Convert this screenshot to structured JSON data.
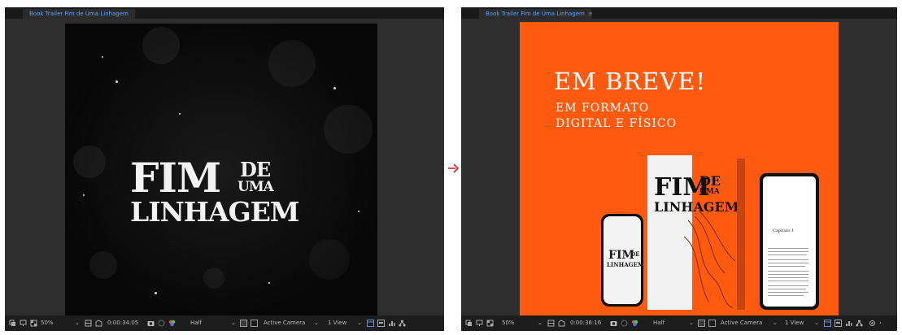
{
  "left_panel": {
    "tab_label": "Book Trailer Fim de Uma Linhagem",
    "logo": {
      "line1_main": "FIM",
      "line1_de": "DE",
      "line1_uma": "UMA",
      "line2": "LINHAGEM"
    },
    "toolbar": {
      "zoom": "50%",
      "timecode": "0:00:34:05",
      "resolution": "Half",
      "camera": "Active Camera",
      "views": "1 View"
    }
  },
  "right_panel": {
    "tab_label": "Book Trailer Fim de Uma Linhagem",
    "tab_menu_glyph": "≡",
    "headline": "EM BREVE!",
    "subline1": "EM FORMATO",
    "subline2": "DIGITAL E FÍSICO",
    "book_logo": {
      "main": "FIM",
      "de": "DE",
      "uma": "UMA",
      "line2": "LINHAGEM"
    },
    "tablet_chapter": "Capítulo 1",
    "toolbar": {
      "zoom": "50%",
      "timecode": "0:00:36:16",
      "resolution": "Half",
      "camera": "Active Camera",
      "views": "1 View"
    }
  },
  "colors": {
    "accent": "#5aa3ff",
    "orange_bg": "#ff5a10",
    "arrow": "#e02020"
  },
  "icons": [
    "toggle-mask-icon",
    "region-of-interest-icon",
    "transparency-grid-icon",
    "snapshot-icon",
    "show-channel-icon",
    "fast-preview-icon",
    "flowchart-icon",
    "arrow-right-icon"
  ]
}
